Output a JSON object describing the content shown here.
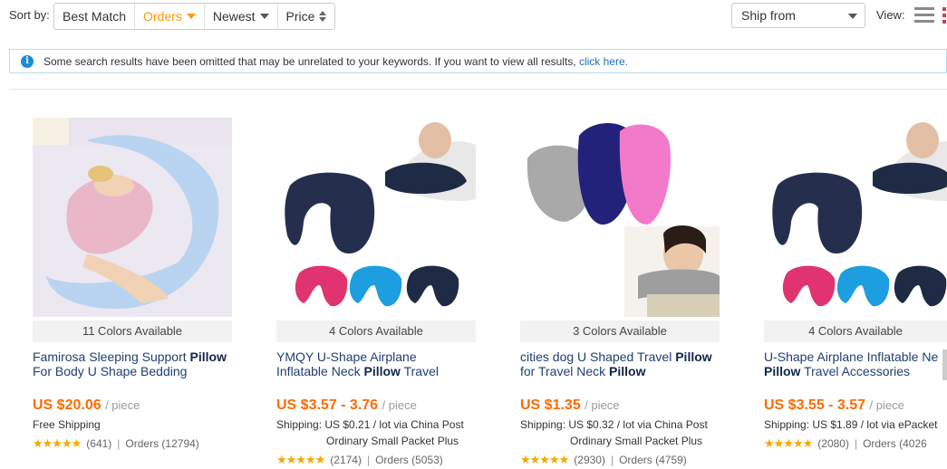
{
  "sortbar": {
    "label": "Sort by:",
    "options": [
      "Best Match",
      "Orders",
      "Newest",
      "Price"
    ],
    "active": "Orders",
    "ship_from": "Ship from",
    "view_label": "View:"
  },
  "notice": {
    "text": "Some search results have been omitted that may be unrelated to your keywords. If you want to view all results,",
    "link": "click here."
  },
  "products": [
    {
      "colors": "11 Colors Available",
      "title_line1_a": "Famirosa Sleeping Support ",
      "title_line1_b": "Pillow",
      "title_line2_a": "For Body U Shape Bedding",
      "title_line2_b": "",
      "price": "US $20.06",
      "unit": "/ piece",
      "shipping1": "Free Shipping",
      "shipping2": "",
      "rating_count": "(641)",
      "orders": "Orders (12794)"
    },
    {
      "colors": "4 Colors Available",
      "title_line1_a": "YMQY U-Shape Airplane",
      "title_line1_b": "",
      "title_line2_a": "Inflatable Neck ",
      "title_line2_b": "Pillow",
      "title_line2_c": " Travel",
      "price": "US $3.57 - 3.76",
      "unit": "/ piece",
      "shipping1": "Shipping: US $0.21 / lot via China Post",
      "shipping2": "Ordinary Small Packet Plus",
      "rating_count": "(2174)",
      "orders": "Orders (5053)"
    },
    {
      "colors": "3 Colors Available",
      "title_line1_a": "cities dog U Shaped Travel ",
      "title_line1_b": "Pillow",
      "title_line2_a": "for Travel Neck ",
      "title_line2_b": "Pillow",
      "price": "US $1.35",
      "unit": "/ piece",
      "shipping1": "Shipping: US $0.32 / lot via China Post",
      "shipping2": "Ordinary Small Packet Plus",
      "rating_count": "(2930)",
      "orders": "Orders (4759)"
    },
    {
      "colors": "4 Colors Available",
      "title_line1_a": "U-Shape Airplane Inflatable Ne",
      "title_line1_b": "",
      "title_line2_a": "",
      "title_line2_b": "Pillow",
      "title_line2_c": " Travel Accessories",
      "price": "US $3.55 - 3.57",
      "unit": "/ piece",
      "shipping1": "Shipping: US $1.89 / lot via ePacket",
      "shipping2": "",
      "rating_count": "(2080)",
      "orders": "Orders (4026"
    }
  ],
  "rating_stars": "★★★★★",
  "divider": "|"
}
